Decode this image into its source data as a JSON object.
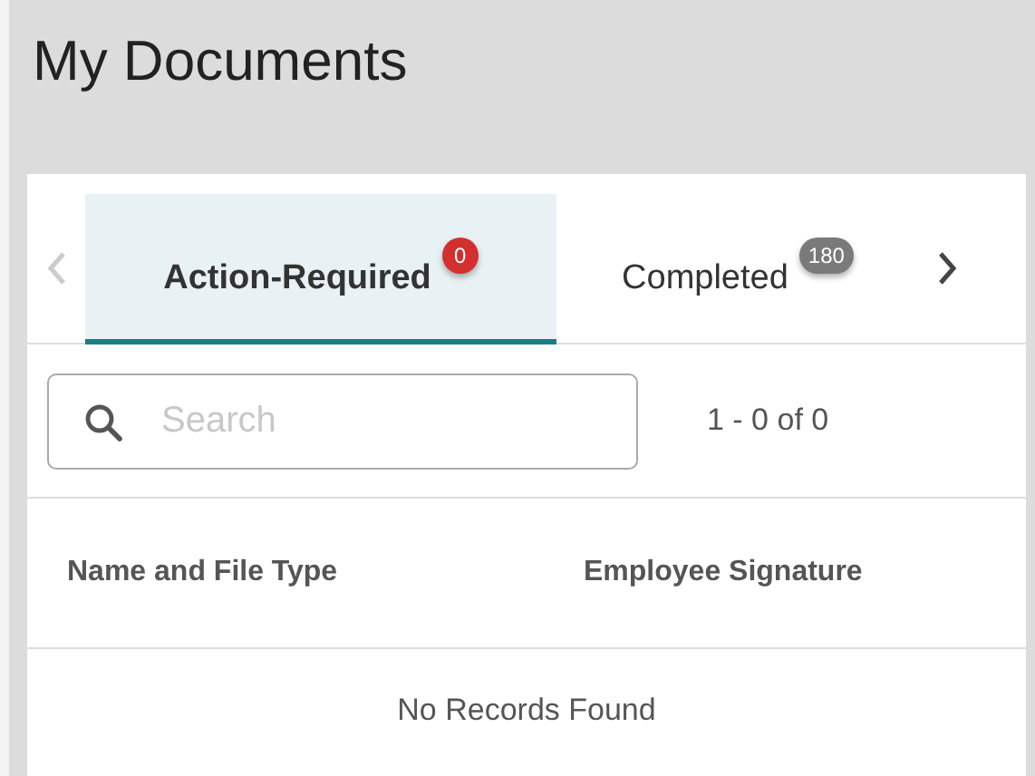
{
  "title": "My Documents",
  "tab_nav": {
    "prev_disabled": true,
    "next_disabled": false
  },
  "tabs": [
    {
      "label": "Action-Required",
      "badge": "0",
      "color": "#d32f2f",
      "selected": true
    },
    {
      "label": "Completed",
      "badge": "180",
      "color": "#7a7a7a",
      "selected": false
    }
  ],
  "search": {
    "placeholder": "Search"
  },
  "range": "1 - 0 of 0",
  "table": {
    "columns": [
      "Name and File Type",
      "Employee Signature"
    ],
    "empty_message": "No Records Found"
  }
}
